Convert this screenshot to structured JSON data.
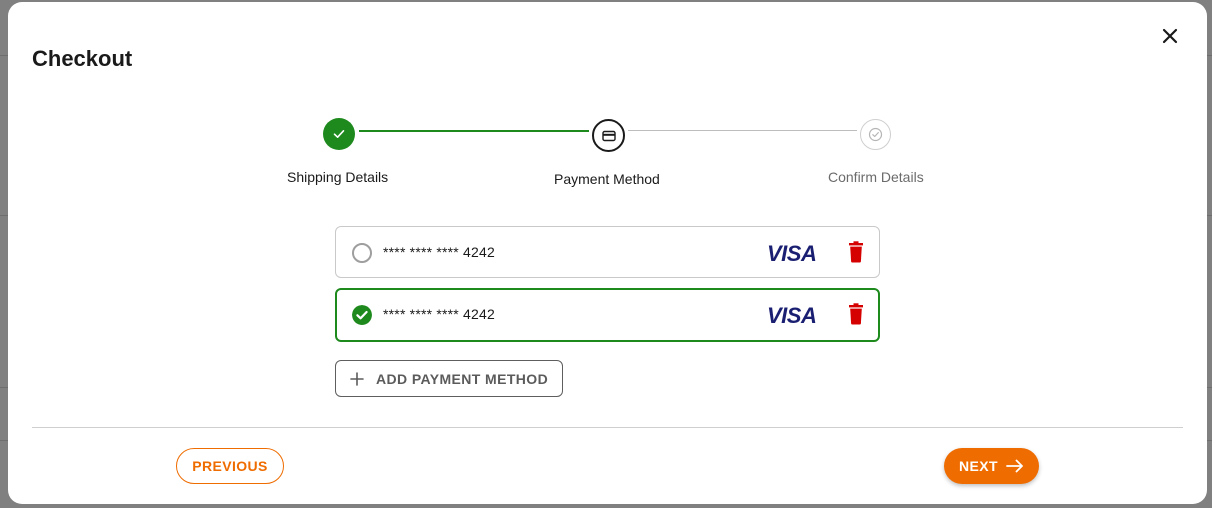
{
  "modal": {
    "title": "Checkout",
    "close_icon": "close-icon"
  },
  "stepper": {
    "steps": [
      {
        "label": "Shipping Details",
        "status": "completed",
        "icon": "check-icon"
      },
      {
        "label": "Payment Method",
        "status": "active",
        "icon": "credit-card-icon"
      },
      {
        "label": "Confirm Details",
        "status": "pending",
        "icon": "check-circle-icon"
      }
    ]
  },
  "payment_methods": [
    {
      "number": "**** **** **** 4242",
      "brand": "VISA",
      "selected": false
    },
    {
      "number": "**** **** **** 4242",
      "brand": "VISA",
      "selected": true
    }
  ],
  "add_payment_label": "ADD PAYMENT METHOD",
  "footer": {
    "previous_label": "PREVIOUS",
    "next_label": "NEXT"
  },
  "colors": {
    "success_green": "#1e8a1e",
    "accent_orange": "#ef6c00",
    "delete_red": "#d50000",
    "visa_blue": "#1a1f71"
  }
}
